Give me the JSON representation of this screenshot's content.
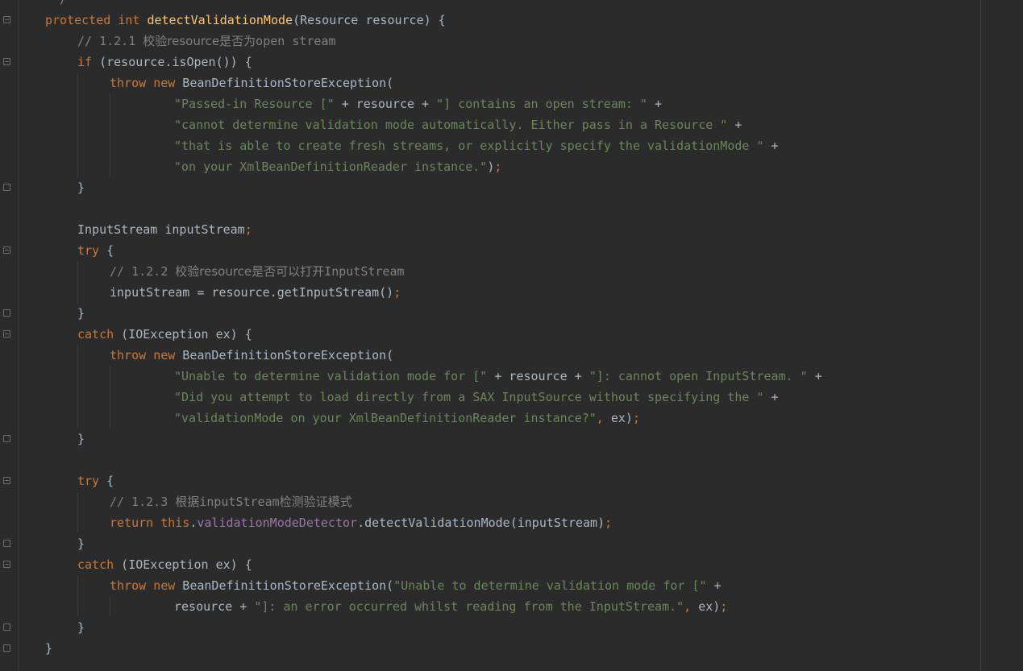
{
  "editor": {
    "language": "Java",
    "theme": "Darcula",
    "colors": {
      "background": "#2b2b2b",
      "keyword": "#cc7832",
      "method_declaration": "#ffc66d",
      "string": "#6a8759",
      "comment": "#808080",
      "field": "#9876aa",
      "default": "#a9b7c6"
    },
    "code": {
      "l0": {
        "t1": " */"
      },
      "l1": {
        "t1": "protected",
        "t2": " ",
        "t3": "int",
        "t4": " ",
        "t5": "detectValidationMode",
        "t6": "(Resource resource) {"
      },
      "l2": {
        "t1": "// 1.2.1 ",
        "t2": "校验resource是否为",
        "t3": "open stream"
      },
      "l3": {
        "t1": "if",
        "t2": " (resource.isOpen()) {"
      },
      "l4": {
        "t1": "throw",
        "t2": " ",
        "t3": "new",
        "t4": " BeanDefinitionStoreException("
      },
      "l5": {
        "t1": "\"Passed-in Resource [\"",
        "t2": " + resource + ",
        "t3": "\"] contains an open stream: \"",
        "t4": " +"
      },
      "l6": {
        "t1": "\"cannot determine validation mode automatically. Either pass in a Resource \"",
        "t2": " +"
      },
      "l7": {
        "t1": "\"that is able to create fresh streams, or explicitly specify the validationMode \"",
        "t2": " +"
      },
      "l8": {
        "t1": "\"on your XmlBeanDefinitionReader instance.\"",
        "t2": ")",
        "t3": ";"
      },
      "l9": {
        "t1": "}"
      },
      "l11": {
        "t1": "InputStream inputStream",
        "t2": ";"
      },
      "l12": {
        "t1": "try",
        "t2": " {"
      },
      "l13": {
        "t1": "// 1.2.2 ",
        "t2": "校验resource是否可以打开",
        "t3": "InputStream"
      },
      "l14": {
        "t1": "inputStream = resource.getInputStream()",
        "t2": ";"
      },
      "l15": {
        "t1": "}"
      },
      "l16": {
        "t1": "catch",
        "t2": " (IOException ex) {"
      },
      "l17": {
        "t1": "throw",
        "t2": " ",
        "t3": "new",
        "t4": " BeanDefinitionStoreException("
      },
      "l18": {
        "t1": "\"Unable to determine validation mode for [\"",
        "t2": " + resource + ",
        "t3": "\"]: cannot open InputStream. \"",
        "t4": " +"
      },
      "l19": {
        "t1": "\"Did you attempt to load directly from a SAX InputSource without specifying the \"",
        "t2": " +"
      },
      "l20": {
        "t1": "\"validationMode on your XmlBeanDefinitionReader instance?\"",
        "t2": ",",
        "t3": " ex)",
        "t4": ";"
      },
      "l21": {
        "t1": "}"
      },
      "l23": {
        "t1": "try",
        "t2": " {"
      },
      "l24": {
        "t1": "// 1.2.3 ",
        "t2": "根据",
        "t3": "inputStream",
        "t4": "检测验证模式"
      },
      "l25": {
        "t1": "return",
        "t2": " ",
        "t3": "this",
        "t4": ".",
        "t5": "validationModeDetector",
        "t6": ".detectValidationMode(inputStream)",
        "t7": ";"
      },
      "l26": {
        "t1": "}"
      },
      "l27": {
        "t1": "catch",
        "t2": " (IOException ex) {"
      },
      "l28": {
        "t1": "throw",
        "t2": " ",
        "t3": "new",
        "t4": " BeanDefinitionStoreException(",
        "t5": "\"Unable to determine validation mode for [\"",
        "t6": " +"
      },
      "l29": {
        "t1": "resource + ",
        "t2": "\"]: an error occurred whilst reading from the InputStream.\"",
        "t3": ",",
        "t4": " ex)",
        "t5": ";"
      },
      "l30": {
        "t1": "}"
      },
      "l31": {
        "t1": "}"
      }
    }
  }
}
